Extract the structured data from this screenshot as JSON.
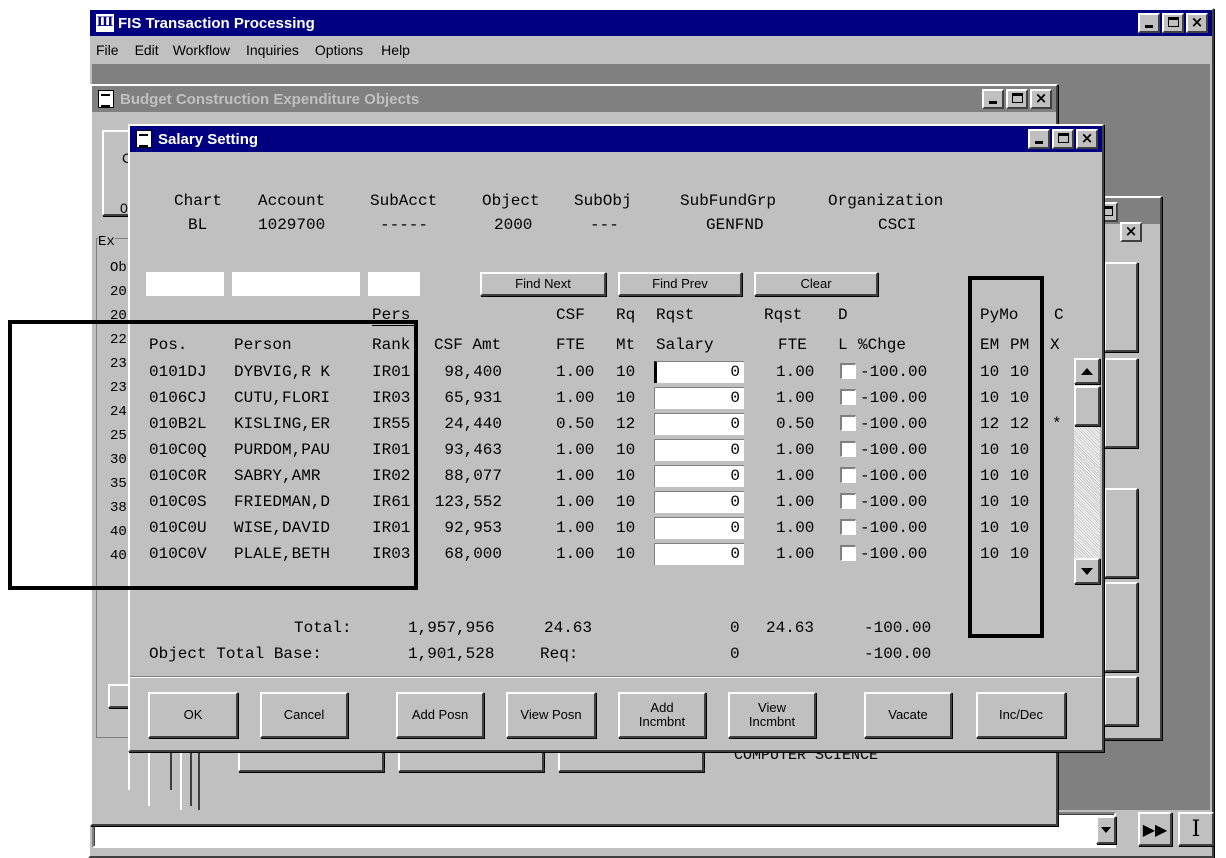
{
  "app": {
    "title": "FIS Transaction Processing",
    "menu": [
      "File",
      "Edit",
      "Workflow",
      "Inquiries",
      "Options",
      "Help"
    ]
  },
  "budget_window": {
    "title": "Budget Construction Expenditure Objects"
  },
  "bg_labels": {
    "ex": "Ex",
    "codes": [
      "Ob",
      "20",
      "20",
      "22",
      "23",
      "23",
      "24",
      "25",
      "30",
      "35",
      "38",
      "40",
      "40"
    ],
    "c": "C",
    "zero": "0",
    "computer_science": "COMPUTER SCIENCE"
  },
  "salary_window": {
    "title": "Salary Setting",
    "header": {
      "labels": [
        "Chart",
        "Account",
        "SubAcct",
        "Object",
        "SubObj",
        "SubFundGrp",
        "Organization"
      ],
      "values": [
        "BL",
        "1029700",
        "-----",
        "2000",
        "---",
        "GENFND",
        "CSCI"
      ]
    },
    "find_next": "Find Next",
    "find_prev": "Find Prev",
    "clear": "Clear",
    "columns": {
      "pers": "Pers",
      "csf": "CSF",
      "rq": "Rq",
      "rqst_top": "Rqst",
      "rqst2_top": "Rqst",
      "d": "D",
      "pymo": "PyMo",
      "c": "C",
      "pos": "Pos.",
      "person": "Person",
      "rank": "Rank",
      "csf_amt": "CSF Amt",
      "fte": "FTE",
      "mt": "Mt",
      "salary": "Salary",
      "fte2": "FTE",
      "l": "L",
      "chge": "%Chge",
      "em": "EM",
      "pm": "PM",
      "x": "X"
    },
    "rows": [
      {
        "pos": "0101DJ",
        "person": "DYBVIG,R K",
        "rank": "IR01",
        "csf_amt": "98,400",
        "fte": "1.00",
        "mt": "10",
        "salary": "0",
        "rqst_fte": "1.00",
        "chge": "-100.00",
        "em": "10",
        "pm": "10",
        "flag": ""
      },
      {
        "pos": "0106CJ",
        "person": "CUTU,FLORI",
        "rank": "IR03",
        "csf_amt": "65,931",
        "fte": "1.00",
        "mt": "10",
        "salary": "0",
        "rqst_fte": "1.00",
        "chge": "-100.00",
        "em": "10",
        "pm": "10",
        "flag": ""
      },
      {
        "pos": "010B2L",
        "person": "KISLING,ER",
        "rank": "IR55",
        "csf_amt": "24,440",
        "fte": "0.50",
        "mt": "12",
        "salary": "0",
        "rqst_fte": "0.50",
        "chge": "-100.00",
        "em": "12",
        "pm": "12",
        "flag": "*"
      },
      {
        "pos": "010C0Q",
        "person": "PURDOM,PAU",
        "rank": "IR01",
        "csf_amt": "93,463",
        "fte": "1.00",
        "mt": "10",
        "salary": "0",
        "rqst_fte": "1.00",
        "chge": "-100.00",
        "em": "10",
        "pm": "10",
        "flag": ""
      },
      {
        "pos": "010C0R",
        "person": "SABRY,AMR",
        "rank": "IR02",
        "csf_amt": "88,077",
        "fte": "1.00",
        "mt": "10",
        "salary": "0",
        "rqst_fte": "1.00",
        "chge": "-100.00",
        "em": "10",
        "pm": "10",
        "flag": ""
      },
      {
        "pos": "010C0S",
        "person": "FRIEDMAN,D",
        "rank": "IR61",
        "csf_amt": "123,552",
        "fte": "1.00",
        "mt": "10",
        "salary": "0",
        "rqst_fte": "1.00",
        "chge": "-100.00",
        "em": "10",
        "pm": "10",
        "flag": ""
      },
      {
        "pos": "010C0U",
        "person": "WISE,DAVID",
        "rank": "IR01",
        "csf_amt": "92,953",
        "fte": "1.00",
        "mt": "10",
        "salary": "0",
        "rqst_fte": "1.00",
        "chge": "-100.00",
        "em": "10",
        "pm": "10",
        "flag": ""
      },
      {
        "pos": "010C0V",
        "person": "PLALE,BETH",
        "rank": "IR03",
        "csf_amt": "68,000",
        "fte": "1.00",
        "mt": "10",
        "salary": "0",
        "rqst_fte": "1.00",
        "chge": "-100.00",
        "em": "10",
        "pm": "10",
        "flag": ""
      }
    ],
    "totals": {
      "total_label": "Total:",
      "total_csf_amt": "1,957,956",
      "total_fte": "24.63",
      "total_salary": "0",
      "total_rqst_fte": "24.63",
      "total_chge": "-100.00",
      "base_label": "Object Total Base:",
      "base_amt": "1,901,528",
      "req_label": "Req:",
      "base_salary": "0",
      "base_chge": "-100.00"
    },
    "buttons": {
      "ok": "OK",
      "cancel": "Cancel",
      "add_posn": "Add Posn",
      "view_posn": "View Posn",
      "add_incmbnt_1": "Add",
      "add_incmbnt_2": "Incmbnt",
      "view_incmbnt_1": "View",
      "view_incmbnt_2": "Incmbnt",
      "vacate": "Vacate",
      "inc_dec": "Inc/Dec"
    }
  },
  "status": {
    "command_value": ""
  }
}
